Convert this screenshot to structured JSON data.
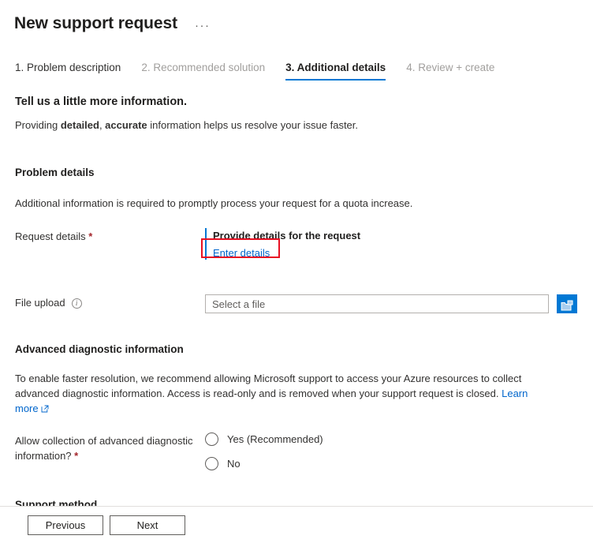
{
  "header": {
    "title": "New support request",
    "ellipsis_label": "···"
  },
  "tabs": [
    {
      "label": "1. Problem description",
      "state": "complete"
    },
    {
      "label": "2. Recommended solution",
      "state": "disabled"
    },
    {
      "label": "3. Additional details",
      "state": "active"
    },
    {
      "label": "4. Review + create",
      "state": "disabled"
    }
  ],
  "intro": {
    "title": "Tell us a little more information.",
    "sub_prefix": "Providing ",
    "sub_bold1": "detailed",
    "sub_mid": ", ",
    "sub_bold2": "accurate",
    "sub_suffix": " information helps us resolve your issue faster."
  },
  "problem_details": {
    "heading": "Problem details",
    "description": "Additional information is required to promptly process your request for a quota increase.",
    "request_details_label": "Request details",
    "request_details_required": "*",
    "provide_details_title": "Provide details for the request",
    "enter_details_link": "Enter details"
  },
  "file_upload": {
    "label": "File upload",
    "info_icon": "info-icon",
    "info_glyph": "i",
    "placeholder": "Select a file",
    "value": "",
    "browse_icon": "folder-icon"
  },
  "advanced_diagnostics": {
    "heading": "Advanced diagnostic information",
    "description": "To enable faster resolution, we recommend allowing Microsoft support to access your Azure resources to collect advanced diagnostic information. Access is read-only and is removed when your support request is closed. ",
    "learn_more": "Learn more",
    "learn_more_icon": "external-link-icon",
    "question_line1": "Allow collection of advanced diagnostic",
    "question_line2": "information?",
    "question_required": "*",
    "options": [
      {
        "label": "Yes (Recommended)",
        "selected": false
      },
      {
        "label": "No",
        "selected": false
      }
    ]
  },
  "support_method": {
    "heading": "Support method"
  },
  "footer": {
    "previous_label": "Previous",
    "next_label": "Next"
  },
  "annotation": {
    "highlight_color": "#e81123",
    "highlight_target": "enter-details-link"
  },
  "colors": {
    "accent": "#0078d4",
    "link": "#0066cc",
    "required": "#a4262c",
    "text": "#323130",
    "disabled_text": "#a19f9d",
    "highlight": "#e81123"
  }
}
